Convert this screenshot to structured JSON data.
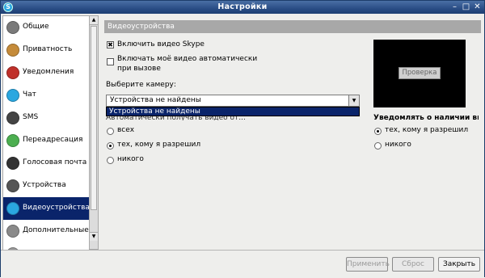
{
  "window": {
    "title": "Настройки",
    "app_icon": "S"
  },
  "titlebar_buttons": {
    "minimize": "–",
    "maximize": "□",
    "close": "✕"
  },
  "sidebar": {
    "items": [
      {
        "label": "Общие",
        "icon": "general-icon",
        "color": "#7a7a7a"
      },
      {
        "label": "Приватность",
        "icon": "privacy-icon",
        "color": "#c58b3a"
      },
      {
        "label": "Уведомления",
        "icon": "notifications-icon",
        "color": "#c0302a"
      },
      {
        "label": "Чат",
        "icon": "chat-icon",
        "color": "#2aa7e0"
      },
      {
        "label": "SMS",
        "icon": "sms-icon",
        "color": "#444444"
      },
      {
        "label": "Переадресация",
        "icon": "forwarding-icon",
        "color": "#4caf50"
      },
      {
        "label": "Голосовая почта",
        "icon": "voicemail-icon",
        "color": "#333333"
      },
      {
        "label": "Устройства",
        "icon": "devices-icon",
        "color": "#555555"
      },
      {
        "label": "Видеоустройства",
        "icon": "video-devices-icon",
        "color": "#2aa7e0",
        "selected": true
      },
      {
        "label": "Дополнительные",
        "icon": "advanced-icon",
        "color": "#8a8a8a"
      },
      {
        "label": "...",
        "icon": "more-icon",
        "color": "#999999"
      }
    ]
  },
  "video": {
    "section_title": "Видеоустройства",
    "enable_video": {
      "label": "Включить видео Skype",
      "checked": true
    },
    "auto_start": {
      "label_line1": "Включать моё видео автоматически",
      "label_line2": "при вызове",
      "checked": false
    },
    "camera_label": "Выберите камеру:",
    "camera_select_value": "Устройства не найдены",
    "dropdown_option": "Устройства не найдены",
    "preview_button": "Проверка",
    "receive_header": "Автоматически получать видео от...",
    "receive_options": [
      "всех",
      "тех, кому я разрешил",
      "никого"
    ],
    "receive_selected": 1,
    "notify_header": "Уведомлять о наличии видео...",
    "notify_options": [
      "тех, кому я разрешил",
      "никого"
    ],
    "notify_selected": 0
  },
  "footer": {
    "apply": "Применить",
    "reset": "Сброс",
    "close": "Закрыть"
  }
}
